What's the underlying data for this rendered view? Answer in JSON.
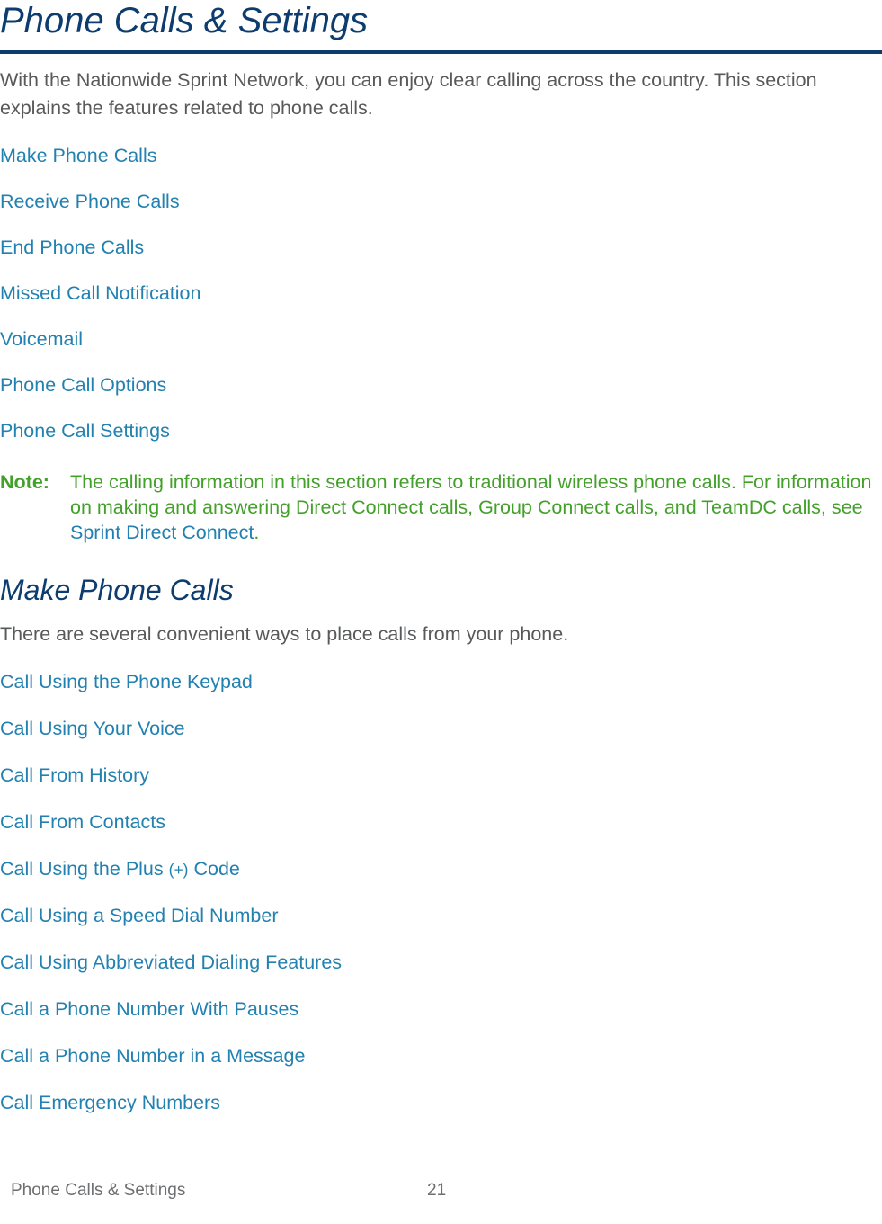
{
  "document": {
    "chapter_title": "Phone Calls & Settings",
    "intro_paragraph": "With the Nationwide Sprint Network, you can enjoy clear calling across the country. This section explains the features related to phone calls.",
    "toc_links": [
      "Make Phone Calls",
      "Receive Phone Calls",
      "End Phone Calls",
      "Missed Call Notification",
      "Voicemail",
      "Phone Call Options",
      "Phone Call Settings"
    ],
    "note": {
      "label": "Note:",
      "text_before_link": "The calling information in this section refers to traditional wireless phone calls. For information on making and answering Direct Connect calls, Group Connect calls, and TeamDC calls, see ",
      "link_text": "Sprint Direct Connect",
      "text_after_link": "."
    },
    "section": {
      "heading": "Make Phone Calls",
      "paragraph": "There are several convenient ways to place calls from your phone.",
      "links": [
        {
          "text": "Call Using the Phone Keypad",
          "paren": "",
          "tail": ""
        },
        {
          "text": "Call Using Your Voice",
          "paren": "",
          "tail": ""
        },
        {
          "text": "Call From History",
          "paren": "",
          "tail": ""
        },
        {
          "text": "Call From Contacts",
          "paren": "",
          "tail": ""
        },
        {
          "text": "Call Using the Plus ",
          "paren": "(+)",
          "tail": " Code"
        },
        {
          "text": "Call Using a Speed Dial Number",
          "paren": "",
          "tail": ""
        },
        {
          "text": "Call Using Abbreviated Dialing Features",
          "paren": "",
          "tail": ""
        },
        {
          "text": "Call a Phone Number With Pauses",
          "paren": "",
          "tail": ""
        },
        {
          "text": "Call a Phone Number in a Message",
          "paren": "",
          "tail": ""
        },
        {
          "text": "Call Emergency Numbers",
          "paren": "",
          "tail": ""
        }
      ]
    },
    "footer": {
      "title": "Phone Calls & Settings",
      "page_number": "21"
    },
    "colors": {
      "heading_navy": "#0d3d6e",
      "link_blue": "#2281b0",
      "body_gray": "#58595b",
      "note_green": "#43a02a",
      "footer_gray": "#6d6e70",
      "page_background": "#ffffff"
    }
  }
}
